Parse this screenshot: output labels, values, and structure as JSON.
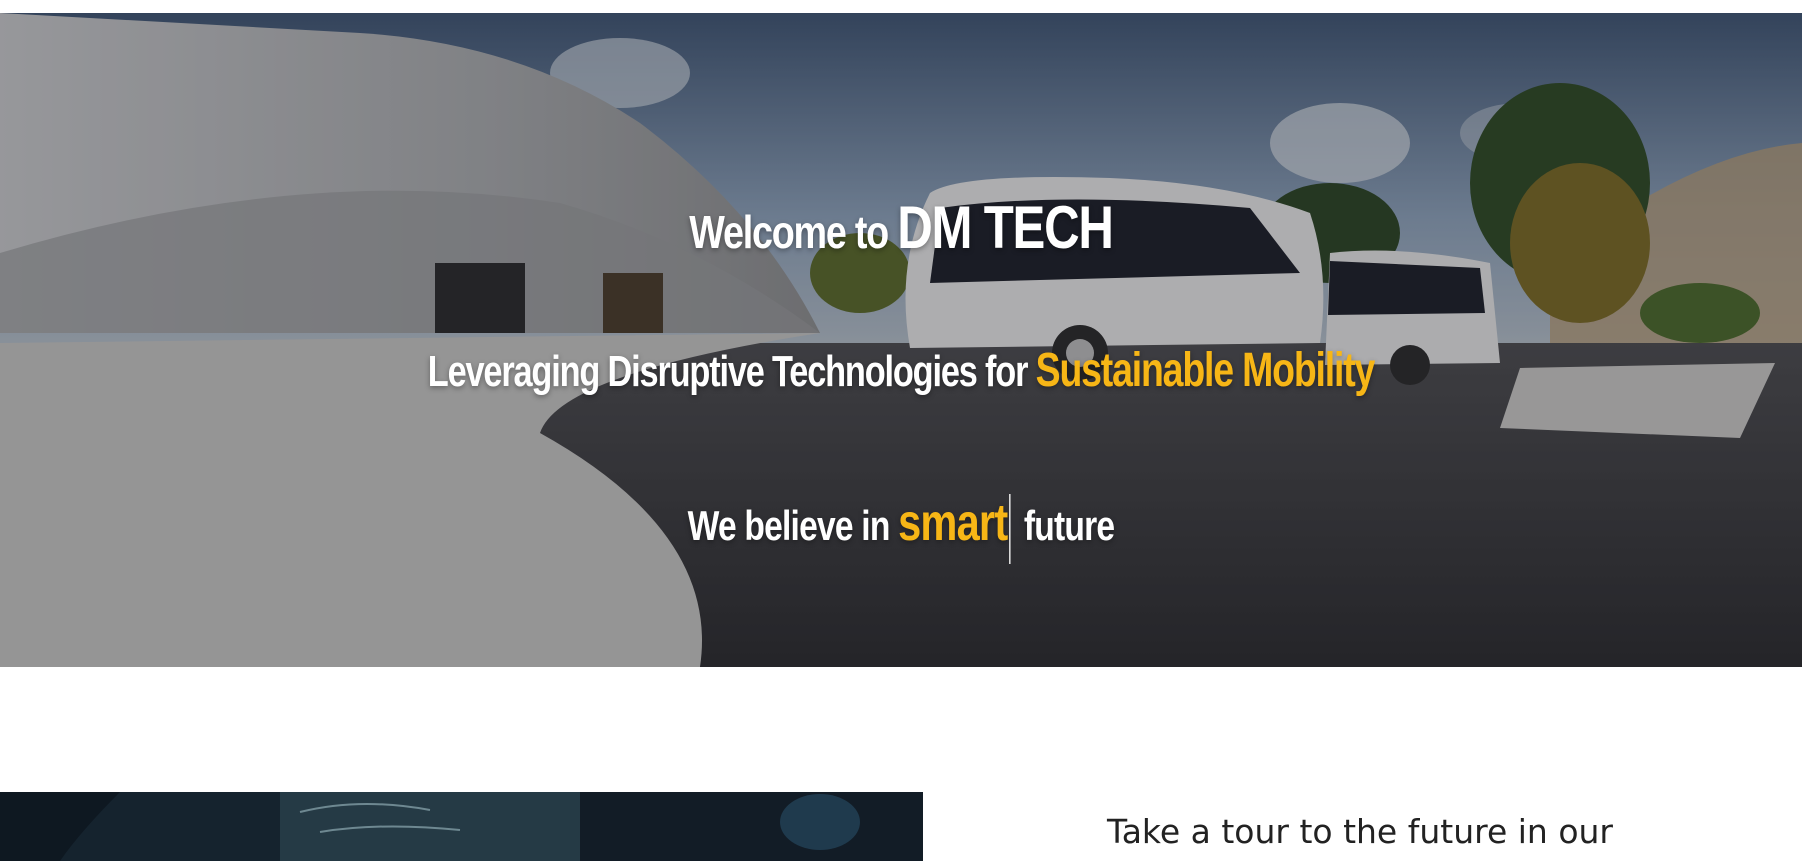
{
  "hero": {
    "welcome_prefix": "Welcome to ",
    "brand": "DM TECH",
    "tagline_prefix": "Leveraging Disruptive Technologies for ",
    "tagline_accent": "Sustainable Mobility",
    "belief_prefix": "We believe in ",
    "belief_accent": "smart",
    "belief_suffix": " future",
    "accent_color": "#f7b616"
  },
  "tour": {
    "title": "Take a tour to the future in our"
  }
}
